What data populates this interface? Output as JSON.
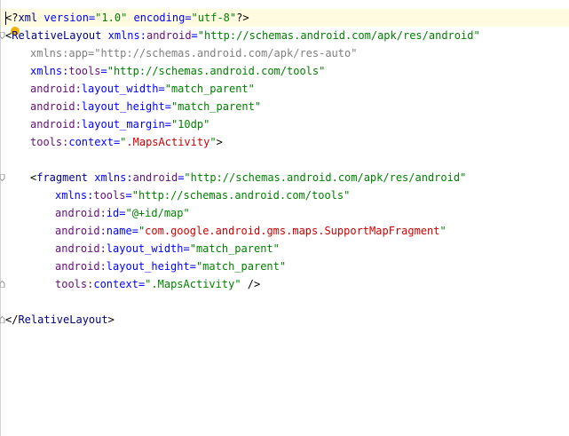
{
  "editor": {
    "lines": {
      "l1": {
        "open": "<?",
        "name": "xml",
        "a1": " version=",
        "v1": "\"1.0\"",
        "a2": " encoding=",
        "v2": "\"utf-8\"",
        "close": "?>"
      },
      "l2": {
        "open": "<",
        "tag": "RelativeLayout",
        "ns": " xmlns:",
        "attr": "android",
        "eq": "=",
        "val": "\"http://schemas.android.com/apk/res/android\""
      },
      "l3": {
        "attr": "xmlns:app=",
        "val": "\"http://schemas.android.com/apk/res-auto\""
      },
      "l4": {
        "ns": "xmlns:",
        "attr": "tools",
        "eq": "=",
        "val": "\"http://schemas.android.com/tools\""
      },
      "l5": {
        "ns": "android:",
        "attr": "layout_width",
        "eq": "=",
        "val": "\"match_parent\""
      },
      "l6": {
        "ns": "android:",
        "attr": "layout_height",
        "eq": "=",
        "val": "\"match_parent\""
      },
      "l7": {
        "ns": "android:",
        "attr": "layout_margin",
        "eq": "=",
        "val": "\"10dp\""
      },
      "l8": {
        "ns": "tools:",
        "attr": "context",
        "eq": "=",
        "q1": "\"",
        "val": ".MapsActivity",
        "q2": "\"",
        "close": ">"
      },
      "l10": {
        "open": "<",
        "tag": "fragment",
        "ns": " xmlns:",
        "attr": "android",
        "eq": "=",
        "val": "\"http://schemas.android.com/apk/res/android\""
      },
      "l11": {
        "ns": "xmlns:",
        "attr": "tools",
        "eq": "=",
        "val": "\"http://schemas.android.com/tools\""
      },
      "l12": {
        "ns": "android:",
        "attr": "id",
        "eq": "=",
        "val": "\"@+id/map\""
      },
      "l13": {
        "ns": "android:",
        "attr": "name",
        "eq": "=",
        "q1": "\"",
        "val": "com.google.android.gms.maps.SupportMapFragment",
        "q2": "\""
      },
      "l14": {
        "ns": "android:",
        "attr": "layout_width",
        "eq": "=",
        "val": "\"match_parent\""
      },
      "l15": {
        "ns": "android:",
        "attr": "layout_height",
        "eq": "=",
        "val": "\"match_parent\""
      },
      "l16": {
        "ns": "tools:",
        "attr": "context",
        "eq": "=",
        "val": "\".MapsActivity\"",
        "close": " />"
      },
      "l18": {
        "open": "</",
        "tag": "RelativeLayout",
        "close": ">"
      }
    }
  },
  "colors": {
    "tag": "#000080",
    "namespace": "#660e7a",
    "attribute": "#0000ff",
    "string": "#008000",
    "unused": "#7f7f7f",
    "error": "#cc0000",
    "current_line": "#fffbe0",
    "bulb": "#f0b400"
  },
  "icons": {
    "intention_bulb": "lightbulb-icon",
    "fold_markers": "fold-marker-icon"
  }
}
